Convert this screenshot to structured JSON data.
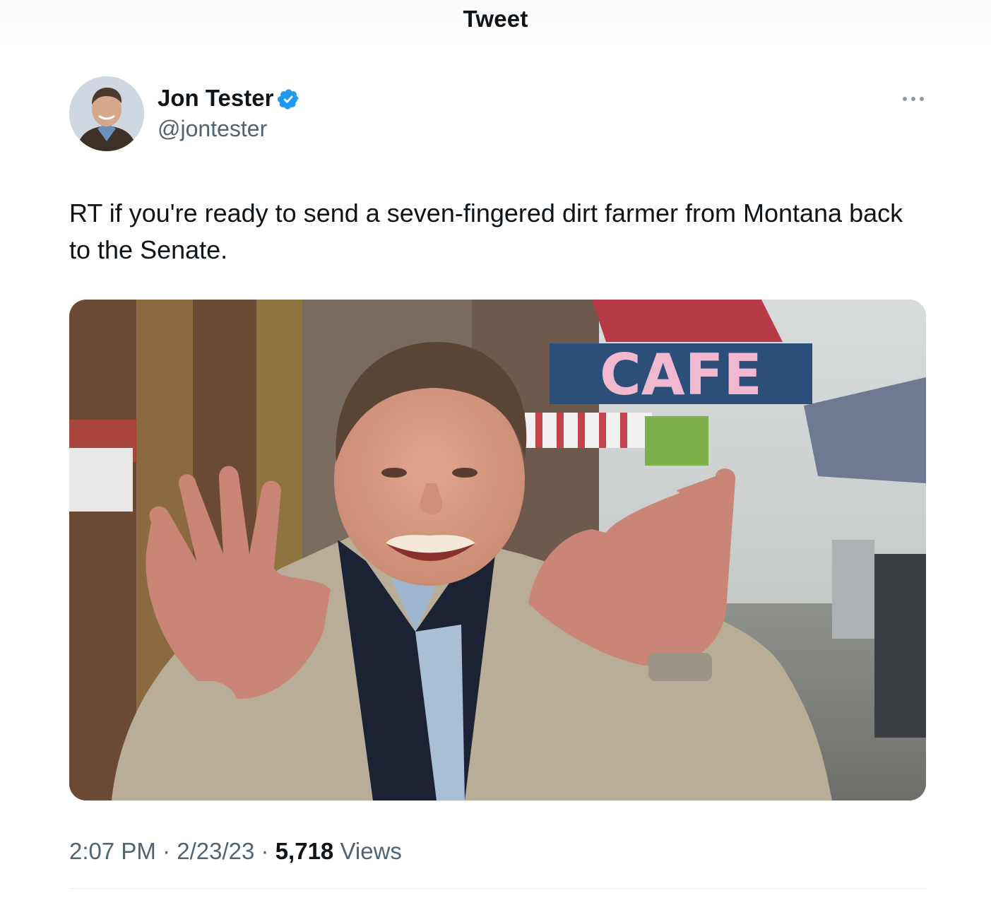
{
  "header": {
    "title": "Tweet"
  },
  "author": {
    "display_name": "Jon Tester",
    "handle": "@jontester",
    "verified": true,
    "avatar_icon": "profile-photo"
  },
  "tweet": {
    "text": "RT if you're ready to send a seven-fingered dirt farmer from Montana back to the Senate.",
    "media": {
      "sign_text": "CAFE"
    }
  },
  "meta": {
    "time": "2:07 PM",
    "separator": "·",
    "date": "2/23/23",
    "views_count": "5,718",
    "views_label": "Views"
  },
  "colors": {
    "text_primary": "#0f1419",
    "text_secondary": "#536471",
    "verified_blue": "#1d9bf0",
    "divider": "#e6ecf0"
  }
}
